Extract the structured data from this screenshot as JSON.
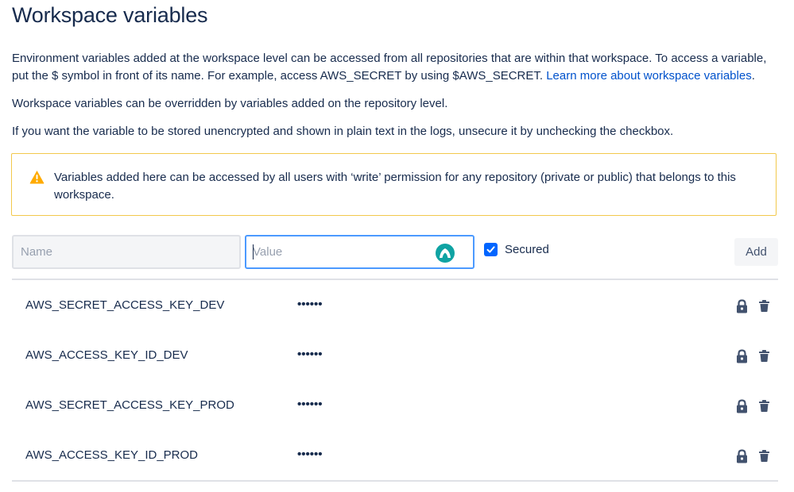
{
  "page": {
    "title": "Workspace variables",
    "intro_prefix": "Environment variables added at the workspace level can be accessed from all repositories that are within that workspace. To access a variable, put the $ symbol in front of its name. For example, access AWS_SECRET by using $AWS_SECRET. ",
    "learn_more_link": "Learn more about workspace variables",
    "intro_suffix": ".",
    "override_text": "Workspace variables can be overridden by variables added on the repository level.",
    "unencrypted_text": "If you want the variable to be stored unencrypted and shown in plain text in the logs, unsecure it by unchecking the checkbox."
  },
  "warning": {
    "icon": "warning-triangle-icon",
    "text": "Variables added here can be accessed by all users with ‘write’ permission for any repository (private or public) that belongs to this workspace."
  },
  "form": {
    "name_placeholder": "Name",
    "name_value": "",
    "value_placeholder": "Value",
    "value_value": "",
    "secured_label": "Secured",
    "secured_checked": true,
    "add_label": "Add"
  },
  "variables": [
    {
      "name": "AWS_SECRET_ACCESS_KEY_DEV",
      "value": "••••••"
    },
    {
      "name": "AWS_ACCESS_KEY_ID_DEV",
      "value": "••••••"
    },
    {
      "name": "AWS_SECRET_ACCESS_KEY_PROD",
      "value": "••••••"
    },
    {
      "name": "AWS_ACCESS_KEY_ID_PROD",
      "value": "••••••"
    }
  ],
  "colors": {
    "text": "#172b4d",
    "link": "#0052cc",
    "warning_border": "#f2c94c",
    "warning_icon": "#ffab00",
    "focus_border": "#4c9aff",
    "checkbox": "#0065ff",
    "icon": "#42526e"
  }
}
